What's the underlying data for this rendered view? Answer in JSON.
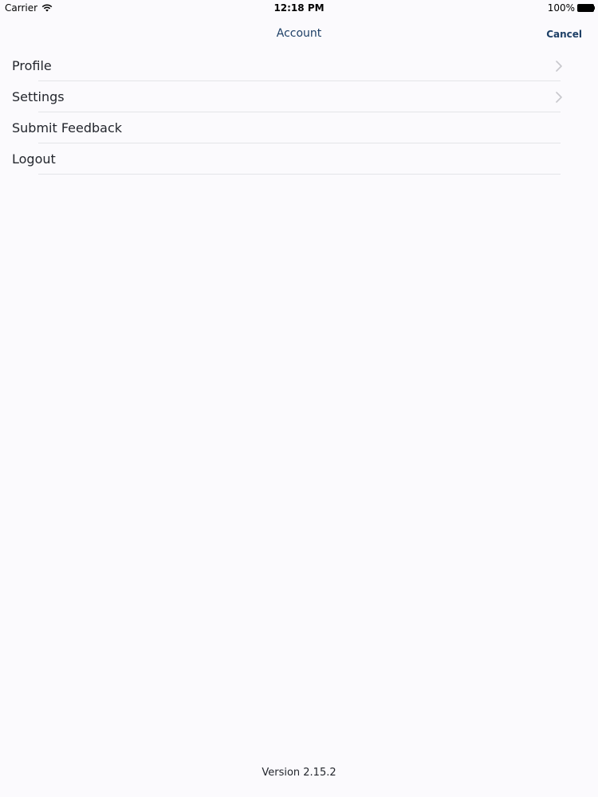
{
  "status_bar": {
    "carrier": "Carrier",
    "wifi_icon": "wifi-icon",
    "time": "12:18 PM",
    "battery_percent": "100%",
    "battery_icon": "battery-full-icon",
    "battery_level": 1.0
  },
  "nav": {
    "title": "Account",
    "cancel_label": "Cancel",
    "accent_color": "#1d3f66"
  },
  "menu": {
    "items": [
      {
        "label": "Profile",
        "has_chevron": true,
        "icon": "chevron-right-icon"
      },
      {
        "label": "Settings",
        "has_chevron": true,
        "icon": "chevron-right-icon"
      },
      {
        "label": "Submit Feedback",
        "has_chevron": false
      },
      {
        "label": "Logout",
        "has_chevron": false
      }
    ]
  },
  "footer": {
    "version": "Version 2.15.2"
  }
}
